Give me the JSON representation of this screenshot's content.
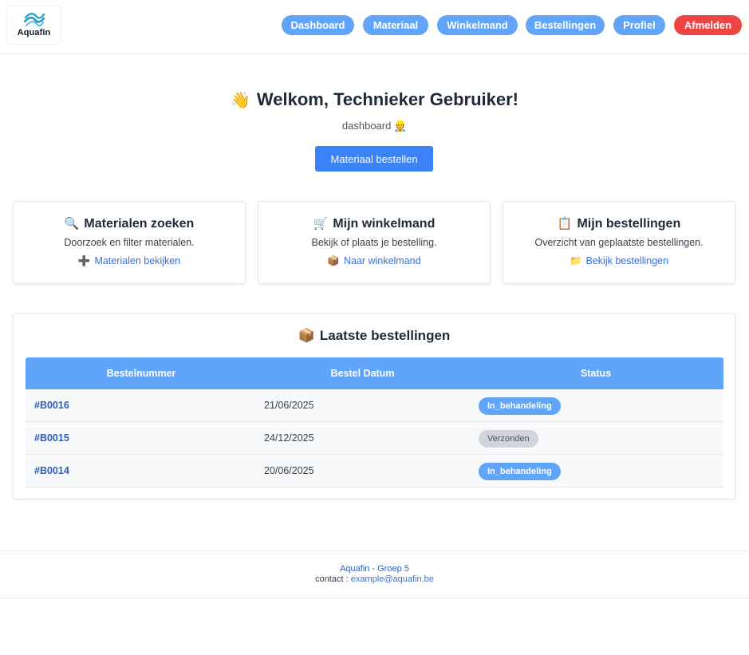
{
  "header": {
    "logo_text": "Aquafin",
    "nav": [
      {
        "label": "Dashboard"
      },
      {
        "label": "Materiaal"
      },
      {
        "label": "Winkelmand"
      },
      {
        "label": "Bestellingen"
      },
      {
        "label": "Profiel"
      },
      {
        "label": "Afmelden"
      }
    ]
  },
  "hero": {
    "wave_icon": "👋",
    "title": "Welkom, Technieker Gebruiker!",
    "subtitle": "dashboard 👷",
    "cta_label": "Materiaal bestellen"
  },
  "cards": [
    {
      "icon": "🔍",
      "title": "Materialen zoeken",
      "desc": "Doorzoek en filter materialen.",
      "link_icon": "➕",
      "link": "Materialen bekijken"
    },
    {
      "icon": "🛒",
      "title": "Mijn winkelmand",
      "desc": "Bekijk of plaats je bestelling.",
      "link_icon": "📦",
      "link": "Naar winkelmand"
    },
    {
      "icon": "📋",
      "title": "Mijn bestellingen",
      "desc": "Overzicht van geplaatste bestellingen.",
      "link_icon": "📁",
      "link": "Bekijk bestellingen"
    }
  ],
  "orders": {
    "icon": "📦",
    "title": "Laatste bestellingen",
    "columns": [
      "Bestelnummer",
      "Bestel Datum",
      "Status"
    ],
    "rows": [
      {
        "number": "#B0016",
        "date": "21/06/2025",
        "status": "In_behandeling"
      },
      {
        "number": "#B0015",
        "date": "24/12/2025",
        "status": "Verzonden"
      },
      {
        "number": "#B0014",
        "date": "20/06/2025",
        "status": "In_behandeling"
      }
    ]
  },
  "footer": {
    "line1": "Aquafin - Groep 5",
    "contact_label": "contact :",
    "email": "example@aquafin.be"
  },
  "colors": {
    "nav_button": "#60a5fa",
    "logout_button": "#ef4444",
    "primary_button": "#3b82f6",
    "table_header": "#60a5fa",
    "badge_in_behandeling": "#60a5fa",
    "badge_verzonden": "#d1d5db"
  }
}
